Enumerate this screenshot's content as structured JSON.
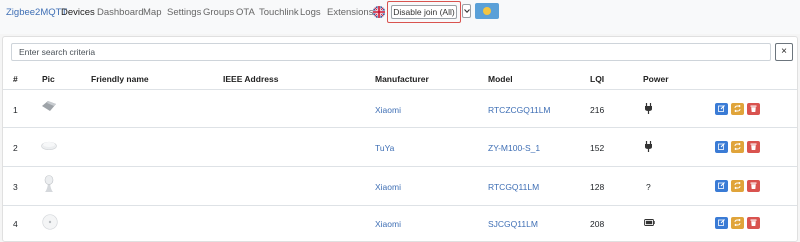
{
  "navbar": {
    "brand": "Zigbee2MQTT",
    "links": [
      "Devices",
      "Dashboard",
      "Map",
      "Settings",
      "Groups",
      "OTA",
      "Touchlink",
      "Logs",
      "Extensions"
    ],
    "active_link": "Devices",
    "join_button_label": "Disable join (All)"
  },
  "search": {
    "placeholder": "Enter search criteria",
    "value": "",
    "clear_label": "×"
  },
  "table": {
    "columns": [
      "#",
      "Pic",
      "Friendly name",
      "IEEE Address",
      "Manufacturer",
      "Model",
      "LQI",
      "Power"
    ],
    "rows": [
      {
        "index": "1",
        "friendly_name": "",
        "ieee": "",
        "manufacturer": "Xiaomi",
        "model": "RTCZCGQ11LM",
        "lqi": "216",
        "power": "plug-icon"
      },
      {
        "index": "2",
        "friendly_name": "",
        "ieee": "",
        "manufacturer": "TuYa",
        "model": "ZY-M100-S_1",
        "lqi": "152",
        "power": "plug-icon"
      },
      {
        "index": "3",
        "friendly_name": "",
        "ieee": "",
        "manufacturer": "Xiaomi",
        "model": "RTCGQ11LM",
        "lqi": "128",
        "power_text": "?"
      },
      {
        "index": "4",
        "friendly_name": "",
        "ieee": "",
        "manufacturer": "Xiaomi",
        "model": "SJCGQ11LM",
        "lqi": "208",
        "power": "battery-icon"
      }
    ]
  },
  "colors": {
    "link": "#3f6fb5",
    "edit": "#3a7bd5",
    "rename": "#e0a43a",
    "remove": "#d9534f",
    "join_highlight": "#d9534f"
  }
}
